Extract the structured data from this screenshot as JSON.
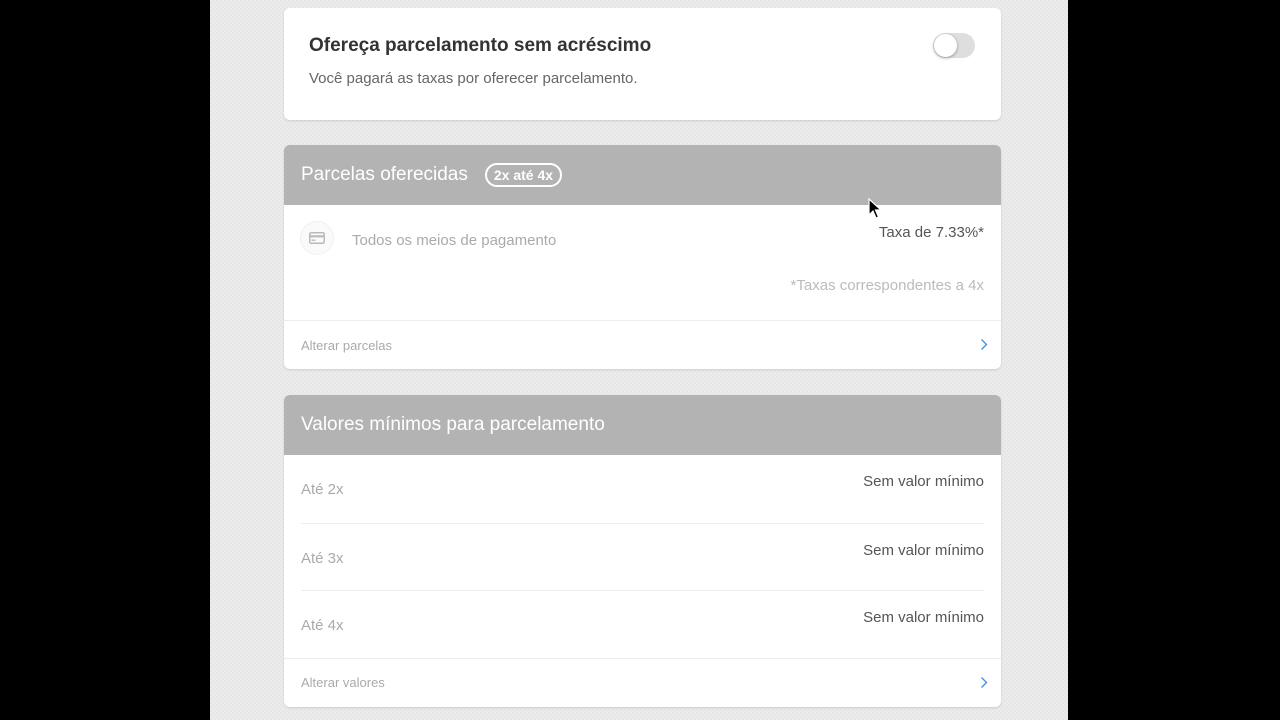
{
  "offer": {
    "title": "Ofereça parcelamento sem acréscimo",
    "description": "Você pagará as taxas por oferecer parcelamento.",
    "toggle_on": false
  },
  "installments": {
    "header_title": "Parcelas oferecidas",
    "badge": "2x até 4x",
    "payment_label": "Todos os meios de pagamento",
    "payment_icon": "credit-card-icon",
    "fee": "Taxa de 7.33%*",
    "fee_note": "*Taxas correspondentes a 4x",
    "link_label": "Alterar parcelas"
  },
  "minimums": {
    "header_title": "Valores mínimos para parcelamento",
    "rows": [
      {
        "label": "Até 2x",
        "value": "Sem valor mínimo"
      },
      {
        "label": "Até 3x",
        "value": "Sem valor mínimo"
      },
      {
        "label": "Até 4x",
        "value": "Sem valor mínimo"
      }
    ],
    "link_label": "Alterar valores"
  },
  "colors": {
    "header_gray": "#b3b3b3",
    "link_blue": "#4a90e2"
  }
}
